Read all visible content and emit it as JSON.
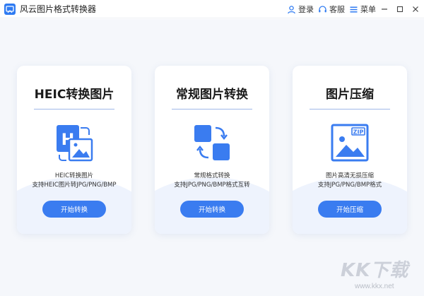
{
  "app": {
    "title": "风云图片格式转换器",
    "accent_color": "#3a7cf0"
  },
  "titlebar": {
    "login_label": "登录",
    "service_label": "客服",
    "menu_label": "菜单"
  },
  "cards": [
    {
      "title": "HEIC转换图片",
      "icon": "heic-image-icon",
      "desc_line1": "HEIC转换图片",
      "desc_line2": "支持HEIC图片转JPG/PNG/BMP",
      "button_label": "开始转换"
    },
    {
      "title": "常规图片转换",
      "icon": "convert-squares-icon",
      "desc_line1": "常规格式转换",
      "desc_line2": "支持JPG/PNG/BMP格式互转",
      "button_label": "开始转换"
    },
    {
      "title": "图片压缩",
      "icon": "zip-image-icon",
      "desc_line1": "图片高清无损压缩",
      "desc_line2": "支持JPG/PNG/BMP格式",
      "button_label": "开始压缩"
    }
  ],
  "watermark": {
    "main": "KK下载",
    "sub": "www.kkx.net"
  }
}
